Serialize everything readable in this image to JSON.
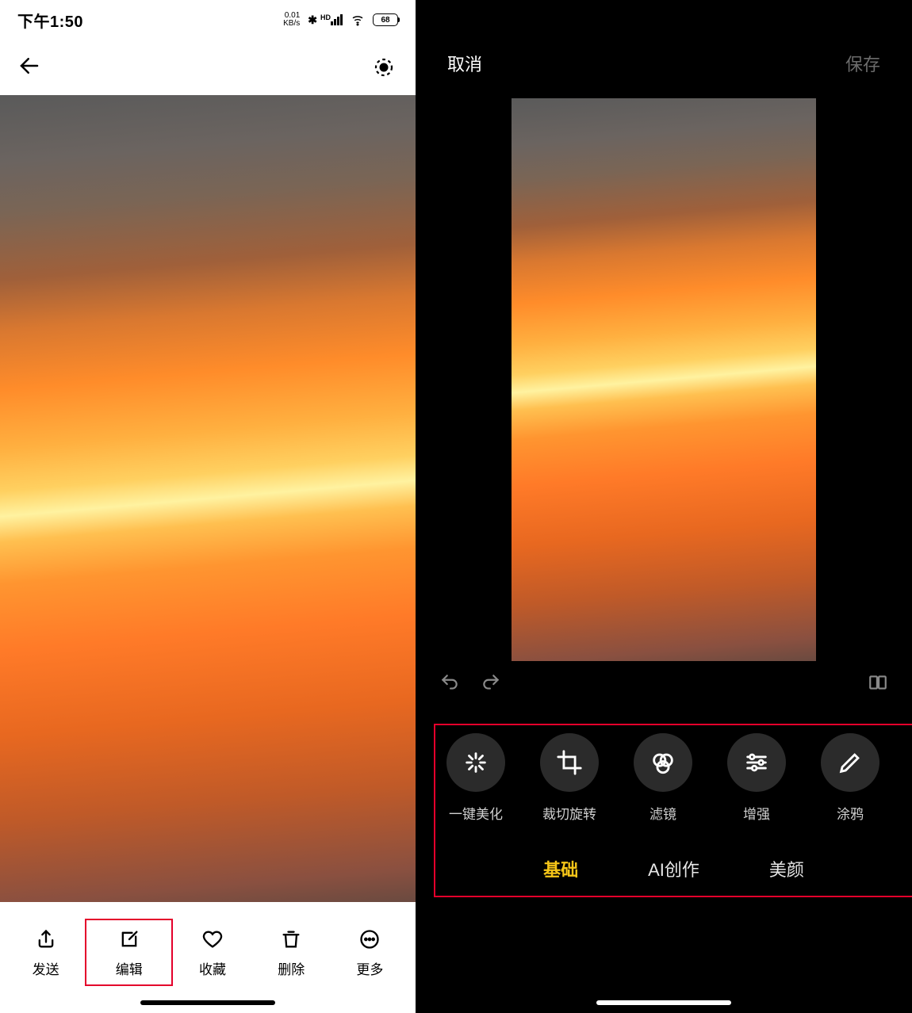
{
  "left": {
    "status": {
      "time": "下午1:50",
      "net_speed_value": "0.01",
      "net_speed_unit": "KB/s",
      "hd": "HD",
      "battery": "68"
    },
    "bottom": {
      "items": [
        {
          "label": "发送",
          "icon": "share-icon"
        },
        {
          "label": "编辑",
          "icon": "edit-icon"
        },
        {
          "label": "收藏",
          "icon": "heart-icon"
        },
        {
          "label": "删除",
          "icon": "trash-icon"
        },
        {
          "label": "更多",
          "icon": "more-icon"
        }
      ]
    }
  },
  "right": {
    "header": {
      "cancel": "取消",
      "save": "保存"
    },
    "tools": [
      {
        "label": "一键美化",
        "icon": "sparkle-icon"
      },
      {
        "label": "裁切旋转",
        "icon": "crop-icon"
      },
      {
        "label": "滤镜",
        "icon": "filter-icon"
      },
      {
        "label": "增强",
        "icon": "adjust-icon"
      },
      {
        "label": "涂鸦",
        "icon": "pencil-icon"
      }
    ],
    "tabs": [
      {
        "label": "基础",
        "active": true
      },
      {
        "label": "AI创作",
        "active": false
      },
      {
        "label": "美颜",
        "active": false
      }
    ]
  }
}
